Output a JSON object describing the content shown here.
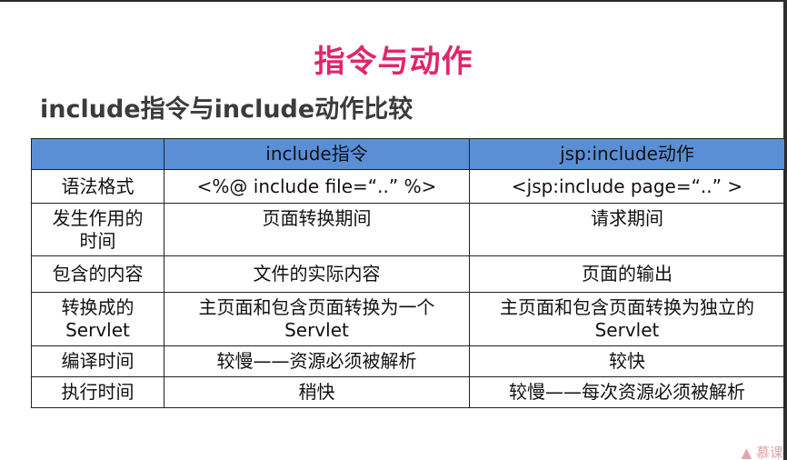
{
  "slide": {
    "title": "指令与动作",
    "subtitle": "include指令与include动作比较"
  },
  "table": {
    "headers": [
      "",
      "include指令",
      "jsp:include动作"
    ],
    "rows": [
      {
        "label": "语法格式",
        "directive": "<%@ include file=“..” %>",
        "action": "<jsp:include page=“..” >"
      },
      {
        "label": "发生作用的\n时间",
        "directive": "页面转换期间",
        "action": "请求期间"
      },
      {
        "label": "包含的内容",
        "directive": "文件的实际内容",
        "action": "页面的输出"
      },
      {
        "label": "转换成的\nServlet",
        "directive": "主页面和包含页面转换为一个\nServlet",
        "action": "主页面和包含页面转换为独立的\nServlet"
      },
      {
        "label": "编译时间",
        "directive": "较慢——资源必须被解析",
        "action": "较快"
      },
      {
        "label": "执行时间",
        "directive": "稍快",
        "action": "较慢——每次资源必须被解析"
      }
    ]
  },
  "watermark": "慕课"
}
